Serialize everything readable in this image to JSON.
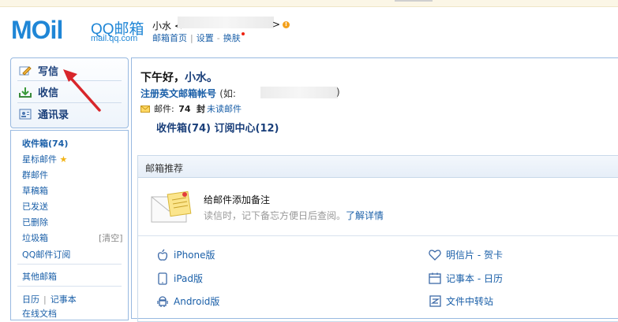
{
  "header": {
    "logo_main": "MOil",
    "logo_qq": "QQ邮箱",
    "logo_url": "mail.qq.com",
    "user_name": "小水",
    "email_open": "<",
    "email_close": ">",
    "warn_glyph": "!",
    "link_home": "邮箱首页",
    "link_settings": "设置",
    "link_skin": "换肤"
  },
  "nav": {
    "compose": "写信",
    "inbox": "收信",
    "contacts": "通讯录"
  },
  "folders": {
    "inbox": "收件箱(74)",
    "starred": "星标邮件",
    "groups": "群邮件",
    "drafts": "草稿箱",
    "sent": "已发送",
    "deleted": "已删除",
    "trash": "垃圾箱",
    "trash_clear": "[清空]",
    "subscriptions": "QQ邮件订阅",
    "other": "其他邮箱",
    "calendar": "日历",
    "notes": "记事本",
    "docs": "在线文档"
  },
  "main": {
    "greeting": "下午好，",
    "greeting_name": "小水。",
    "register_link": "注册英文邮箱帐号",
    "register_paren": "(如:",
    "register_close": ")",
    "mail_label": "邮件:",
    "mail_count": "74",
    "mail_unit": "封",
    "mail_unread": "未读邮件",
    "inbox_link": "收件箱(74)",
    "subscribe_link": "订阅中心(12)"
  },
  "recommend": {
    "title": "邮箱推荐",
    "tip_title": "给邮件添加备注",
    "tip_text": "读信时，记下备忘方便日后查阅。",
    "tip_link": "了解详情",
    "apps": {
      "iphone": "iPhone版",
      "ipad": "iPad版",
      "android": "Android版",
      "postcard": "明信片 - 贺卡",
      "notes_cal": "记事本 - 日历",
      "transfer": "文件中转站"
    }
  },
  "colors": {
    "brand_blue": "#1f86d6",
    "logo_orange": "#f7a11a",
    "link_blue": "#1a5fa8",
    "border_blue": "#98b9e0",
    "arrow_red": "#d8262b"
  }
}
